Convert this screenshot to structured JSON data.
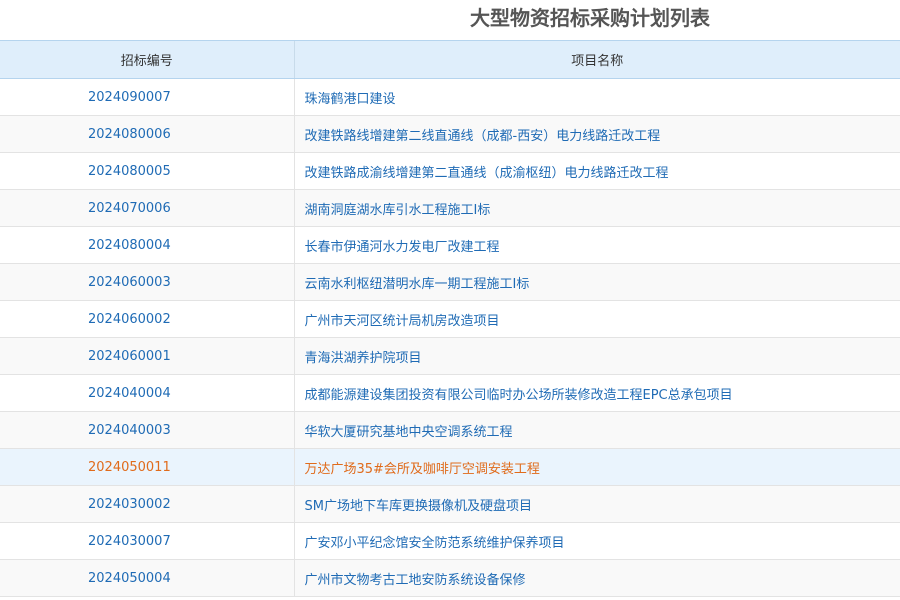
{
  "page": {
    "title": "大型物资招标采购计划列表"
  },
  "table": {
    "headers": [
      "招标编号",
      "项目名称"
    ],
    "rows": [
      {
        "code": "2024090007",
        "name": "珠海鹤港口建设"
      },
      {
        "code": "2024080006",
        "name": "改建铁路线增建第二线直通线（成都-西安）电力线路迁改工程"
      },
      {
        "code": "2024080005",
        "name": "改建铁路成渝线增建第二直通线（成渝枢纽）电力线路迁改工程"
      },
      {
        "code": "2024070006",
        "name": "湖南洞庭湖水库引水工程施工I标"
      },
      {
        "code": "2024080004",
        "name": "长春市伊通河水力发电厂改建工程"
      },
      {
        "code": "2024060003",
        "name": "云南水利枢纽潜明水库一期工程施工I标"
      },
      {
        "code": "2024060002",
        "name": "广州市天河区统计局机房改造项目"
      },
      {
        "code": "2024060001",
        "name": "青海洪湖养护院项目"
      },
      {
        "code": "2024040004",
        "name": "成都能源建设集团投资有限公司临时办公场所装修改造工程EPC总承包项目"
      },
      {
        "code": "2024040003",
        "name": "华软大厦研究基地中央空调系统工程"
      },
      {
        "code": "2024050011",
        "name": "万达广场35#会所及咖啡厅空调安装工程"
      },
      {
        "code": "2024030002",
        "name": "SM广场地下车库更换摄像机及硬盘项目"
      },
      {
        "code": "2024030007",
        "name": "广安邓小平纪念馆安全防范系统维护保养项目"
      },
      {
        "code": "2024050004",
        "name": "广州市文物考古工地安防系统设备保修"
      }
    ]
  },
  "colors": {
    "link": "#1f6bb5",
    "highlight_text": "#e06b1b",
    "header_bg": "#dfeefb",
    "highlight_bg": "#eaf4fd",
    "title_text": "#555555"
  }
}
